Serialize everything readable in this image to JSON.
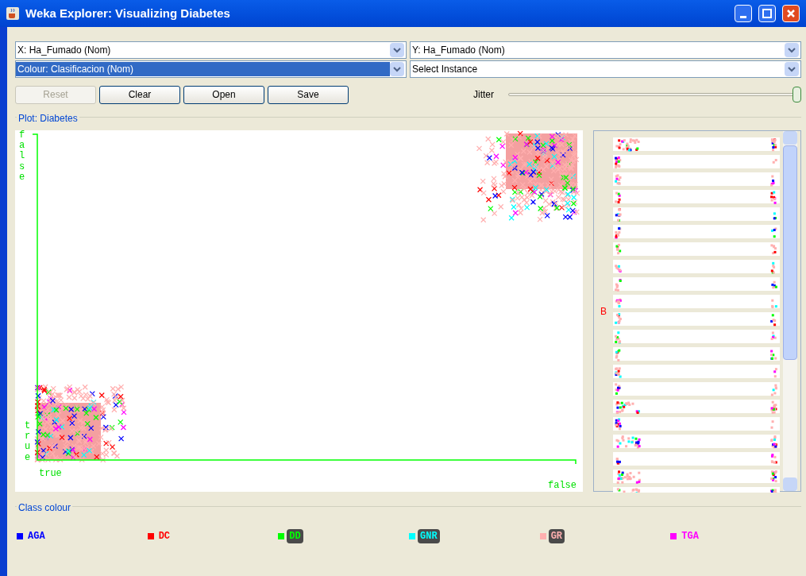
{
  "window": {
    "title": "Weka Explorer: Visualizing Diabetes"
  },
  "selectors": [
    {
      "label": "X: Ha_Fumado (Nom)",
      "selected": false
    },
    {
      "label": "Y: Ha_Fumado (Nom)",
      "selected": false
    },
    {
      "label": "Colour: Clasificacion (Nom)",
      "selected": true
    },
    {
      "label": "Select Instance",
      "selected": false
    }
  ],
  "buttons": [
    {
      "label": "Reset",
      "disabled": true
    },
    {
      "label": "Clear",
      "disabled": false
    },
    {
      "label": "Open",
      "disabled": false
    },
    {
      "label": "Save",
      "disabled": false
    }
  ],
  "jitter": {
    "label": "Jitter",
    "level": 1
  },
  "plot": {
    "title": "Plot: Diabetes",
    "y_top": "false",
    "y_bottom": "true",
    "x_left": "true",
    "x_right": "false"
  },
  "attribute_panel": {
    "label": "B"
  },
  "class_colour": {
    "title": "Class colour",
    "classes": [
      {
        "name": "AGA",
        "color": "#0000ff"
      },
      {
        "name": "DC",
        "color": "#ff0000"
      },
      {
        "name": "DD",
        "color": "#00ff00"
      },
      {
        "name": "GNR",
        "color": "#00ffff"
      },
      {
        "name": "GR",
        "color": "#ffafaf"
      },
      {
        "name": "TGA",
        "color": "#ff00ff"
      }
    ]
  }
}
